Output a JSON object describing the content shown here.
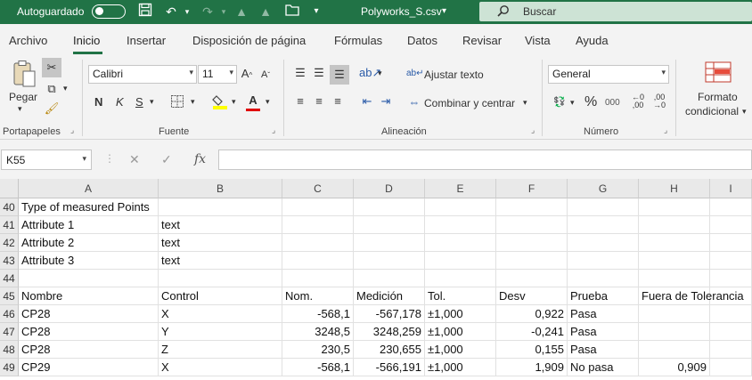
{
  "titlebar": {
    "autosave_label": "Autoguardado",
    "filename": "Polyworks_S.csv",
    "filename_dropdown": "▾",
    "search_placeholder": "Buscar",
    "accent_color": "#217346"
  },
  "menu": {
    "tabs": [
      "Archivo",
      "Inicio",
      "Insertar",
      "Disposición de página",
      "Fórmulas",
      "Datos",
      "Revisar",
      "Vista",
      "Ayuda"
    ],
    "active": "Inicio"
  },
  "ribbon": {
    "clipboard": {
      "paste_label": "Pegar",
      "group_label": "Portapapeles"
    },
    "font": {
      "font_name": "Calibri",
      "font_size": "11",
      "bold": "N",
      "italic": "K",
      "underline": "S",
      "group_label": "Fuente"
    },
    "alignment": {
      "wrap_text": "Ajustar texto",
      "merge_center": "Combinar y centrar",
      "group_label": "Alineación"
    },
    "number": {
      "format": "General",
      "percent": "%",
      "thousands": "000",
      "group_label": "Número"
    },
    "styles": {
      "conditional_format_line1": "Formato",
      "conditional_format_line2": "condicional"
    }
  },
  "formula_bar": {
    "name_box": "K55",
    "fx": "fx",
    "formula": ""
  },
  "sheet": {
    "columns": [
      "A",
      "B",
      "C",
      "D",
      "E",
      "F",
      "G",
      "H",
      "I"
    ],
    "rows": [
      {
        "n": "40",
        "cells": [
          "Type of measured Points",
          "",
          "",
          "",
          "",
          "",
          "",
          "",
          ""
        ]
      },
      {
        "n": "41",
        "cells": [
          "Attribute 1",
          "text",
          "",
          "",
          "",
          "",
          "",
          "",
          ""
        ]
      },
      {
        "n": "42",
        "cells": [
          "Attribute 2",
          "text",
          "",
          "",
          "",
          "",
          "",
          "",
          ""
        ]
      },
      {
        "n": "43",
        "cells": [
          "Attribute 3",
          "text",
          "",
          "",
          "",
          "",
          "",
          "",
          ""
        ]
      },
      {
        "n": "44",
        "cells": [
          "",
          "",
          "",
          "",
          "",
          "",
          "",
          "",
          ""
        ]
      },
      {
        "n": "45",
        "cells": [
          "Nombre",
          "Control",
          "Nom.",
          "Medición",
          "Tol.",
          "Desv",
          "Prueba",
          "Fuera de Tolerancia",
          ""
        ]
      },
      {
        "n": "46",
        "cells": [
          "CP28",
          "X",
          "-568,1",
          "-567,178",
          "±1,000",
          "0,922",
          "Pasa",
          "",
          ""
        ]
      },
      {
        "n": "47",
        "cells": [
          "CP28",
          "Y",
          "3248,5",
          "3248,259",
          "±1,000",
          "-0,241",
          "Pasa",
          "",
          ""
        ]
      },
      {
        "n": "48",
        "cells": [
          "CP28",
          "Z",
          "230,5",
          "230,655",
          "±1,000",
          "0,155",
          "Pasa",
          "",
          ""
        ]
      },
      {
        "n": "49",
        "cells": [
          "CP29",
          "X",
          "-568,1",
          "-566,191",
          "±1,000",
          "1,909",
          "No pasa",
          "0,909",
          ""
        ]
      }
    ]
  }
}
